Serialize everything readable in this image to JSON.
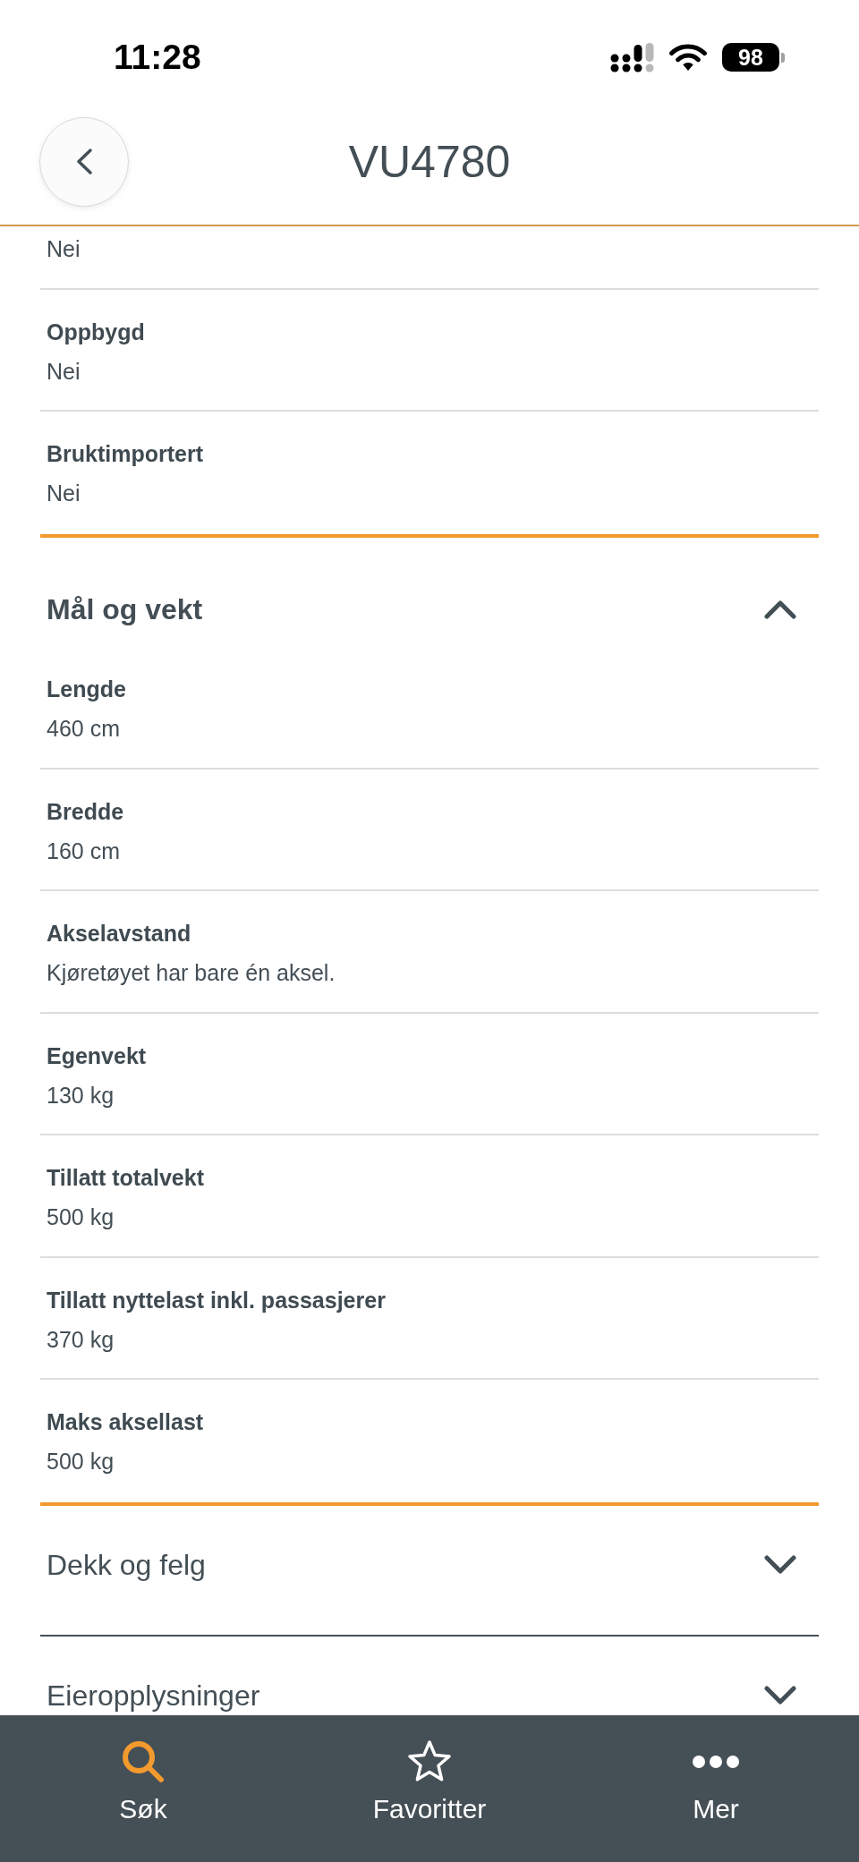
{
  "status_bar": {
    "time": "11:28",
    "battery": "98"
  },
  "header": {
    "title": "VU4780"
  },
  "sections": [
    {
      "expanded": true,
      "rows": [
        {
          "value": "Nei"
        },
        {
          "label": "Oppbygd",
          "value": "Nei"
        },
        {
          "label": "Bruktimportert",
          "value": "Nei"
        }
      ]
    },
    {
      "title": "Mål og vekt",
      "expanded": true,
      "rows": [
        {
          "label": "Lengde",
          "value": "460 cm"
        },
        {
          "label": "Bredde",
          "value": "160 cm"
        },
        {
          "label": "Akselavstand",
          "value": "Kjøretøyet har bare én aksel."
        },
        {
          "label": "Egenvekt",
          "value": "130 kg"
        },
        {
          "label": "Tillatt totalvekt",
          "value": "500 kg"
        },
        {
          "label": "Tillatt nyttelast inkl. passasjerer",
          "value": "370 kg"
        },
        {
          "label": "Maks aksellast",
          "value": "500 kg"
        }
      ]
    },
    {
      "title": "Dekk og felg",
      "expanded": false
    },
    {
      "title": "Eieropplysninger",
      "expanded": false
    }
  ],
  "tab_bar": [
    {
      "label": "Søk",
      "selected": true
    },
    {
      "label": "Favoritter",
      "selected": false
    },
    {
      "label": "Mer",
      "selected": false
    }
  ]
}
